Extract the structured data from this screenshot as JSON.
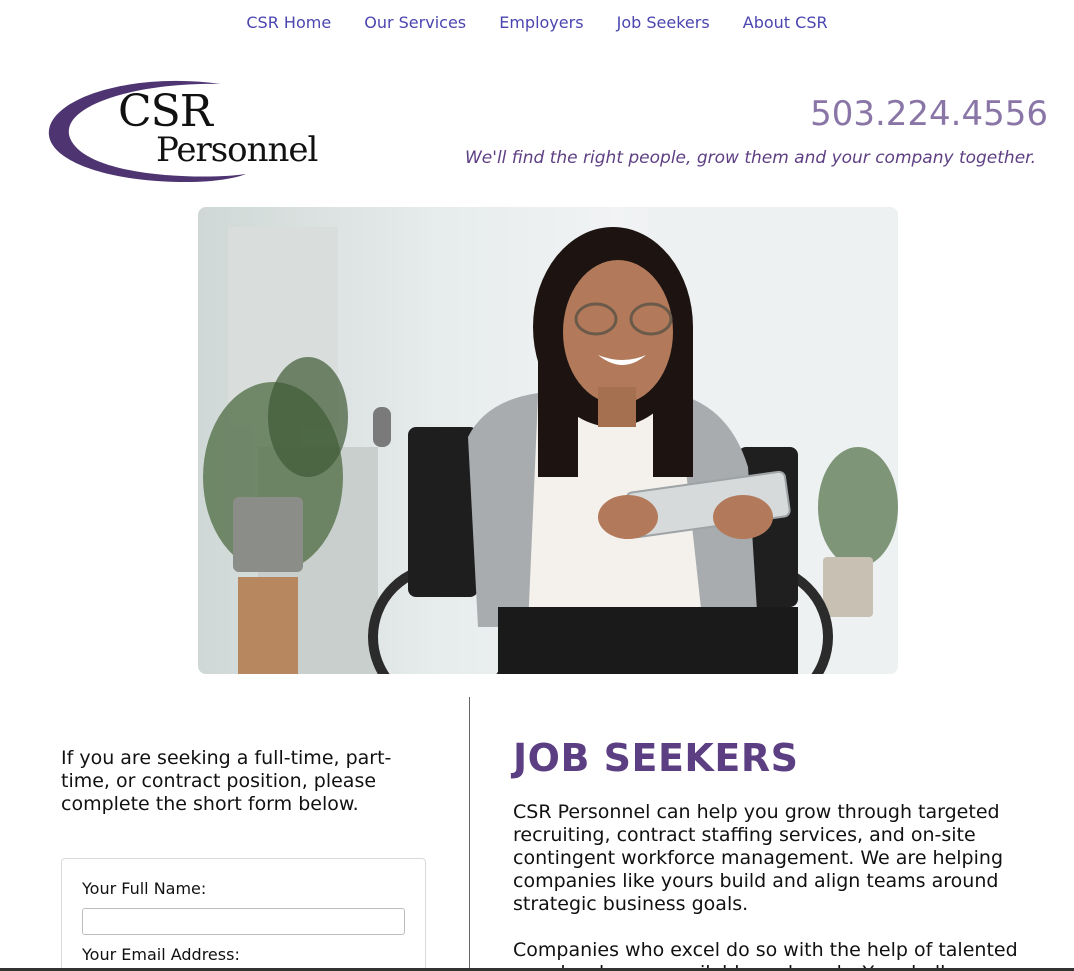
{
  "nav": {
    "items": [
      "CSR Home",
      "Our Services",
      "Employers",
      "Job Seekers",
      "About CSR"
    ]
  },
  "logo": {
    "line1": "CSR",
    "line2": "Personnel"
  },
  "header": {
    "phone": "503.224.4556",
    "tagline": "We'll find the right people, grow them and your company together."
  },
  "intro": {
    "text": "If you are seeking a full-time, part-time, or contract position, please complete the short form below."
  },
  "form": {
    "full_name_label": "Your Full Name:",
    "full_name_value": "",
    "email_label": "Your Email Address:"
  },
  "main": {
    "heading": "JOB SEEKERS",
    "paragraph1": "CSR Personnel can help you grow through targeted recruiting, contract staffing services, and on-site contingent workforce management. We are helping companies like yours build and align teams around strategic business goals.",
    "paragraph2": "Companies who excel do so with the help of talented people who are available and ready. You shall"
  },
  "colors": {
    "nav_link": "#4b45b0",
    "brand_purple": "#5b3f82",
    "phone": "#8a76a6"
  }
}
